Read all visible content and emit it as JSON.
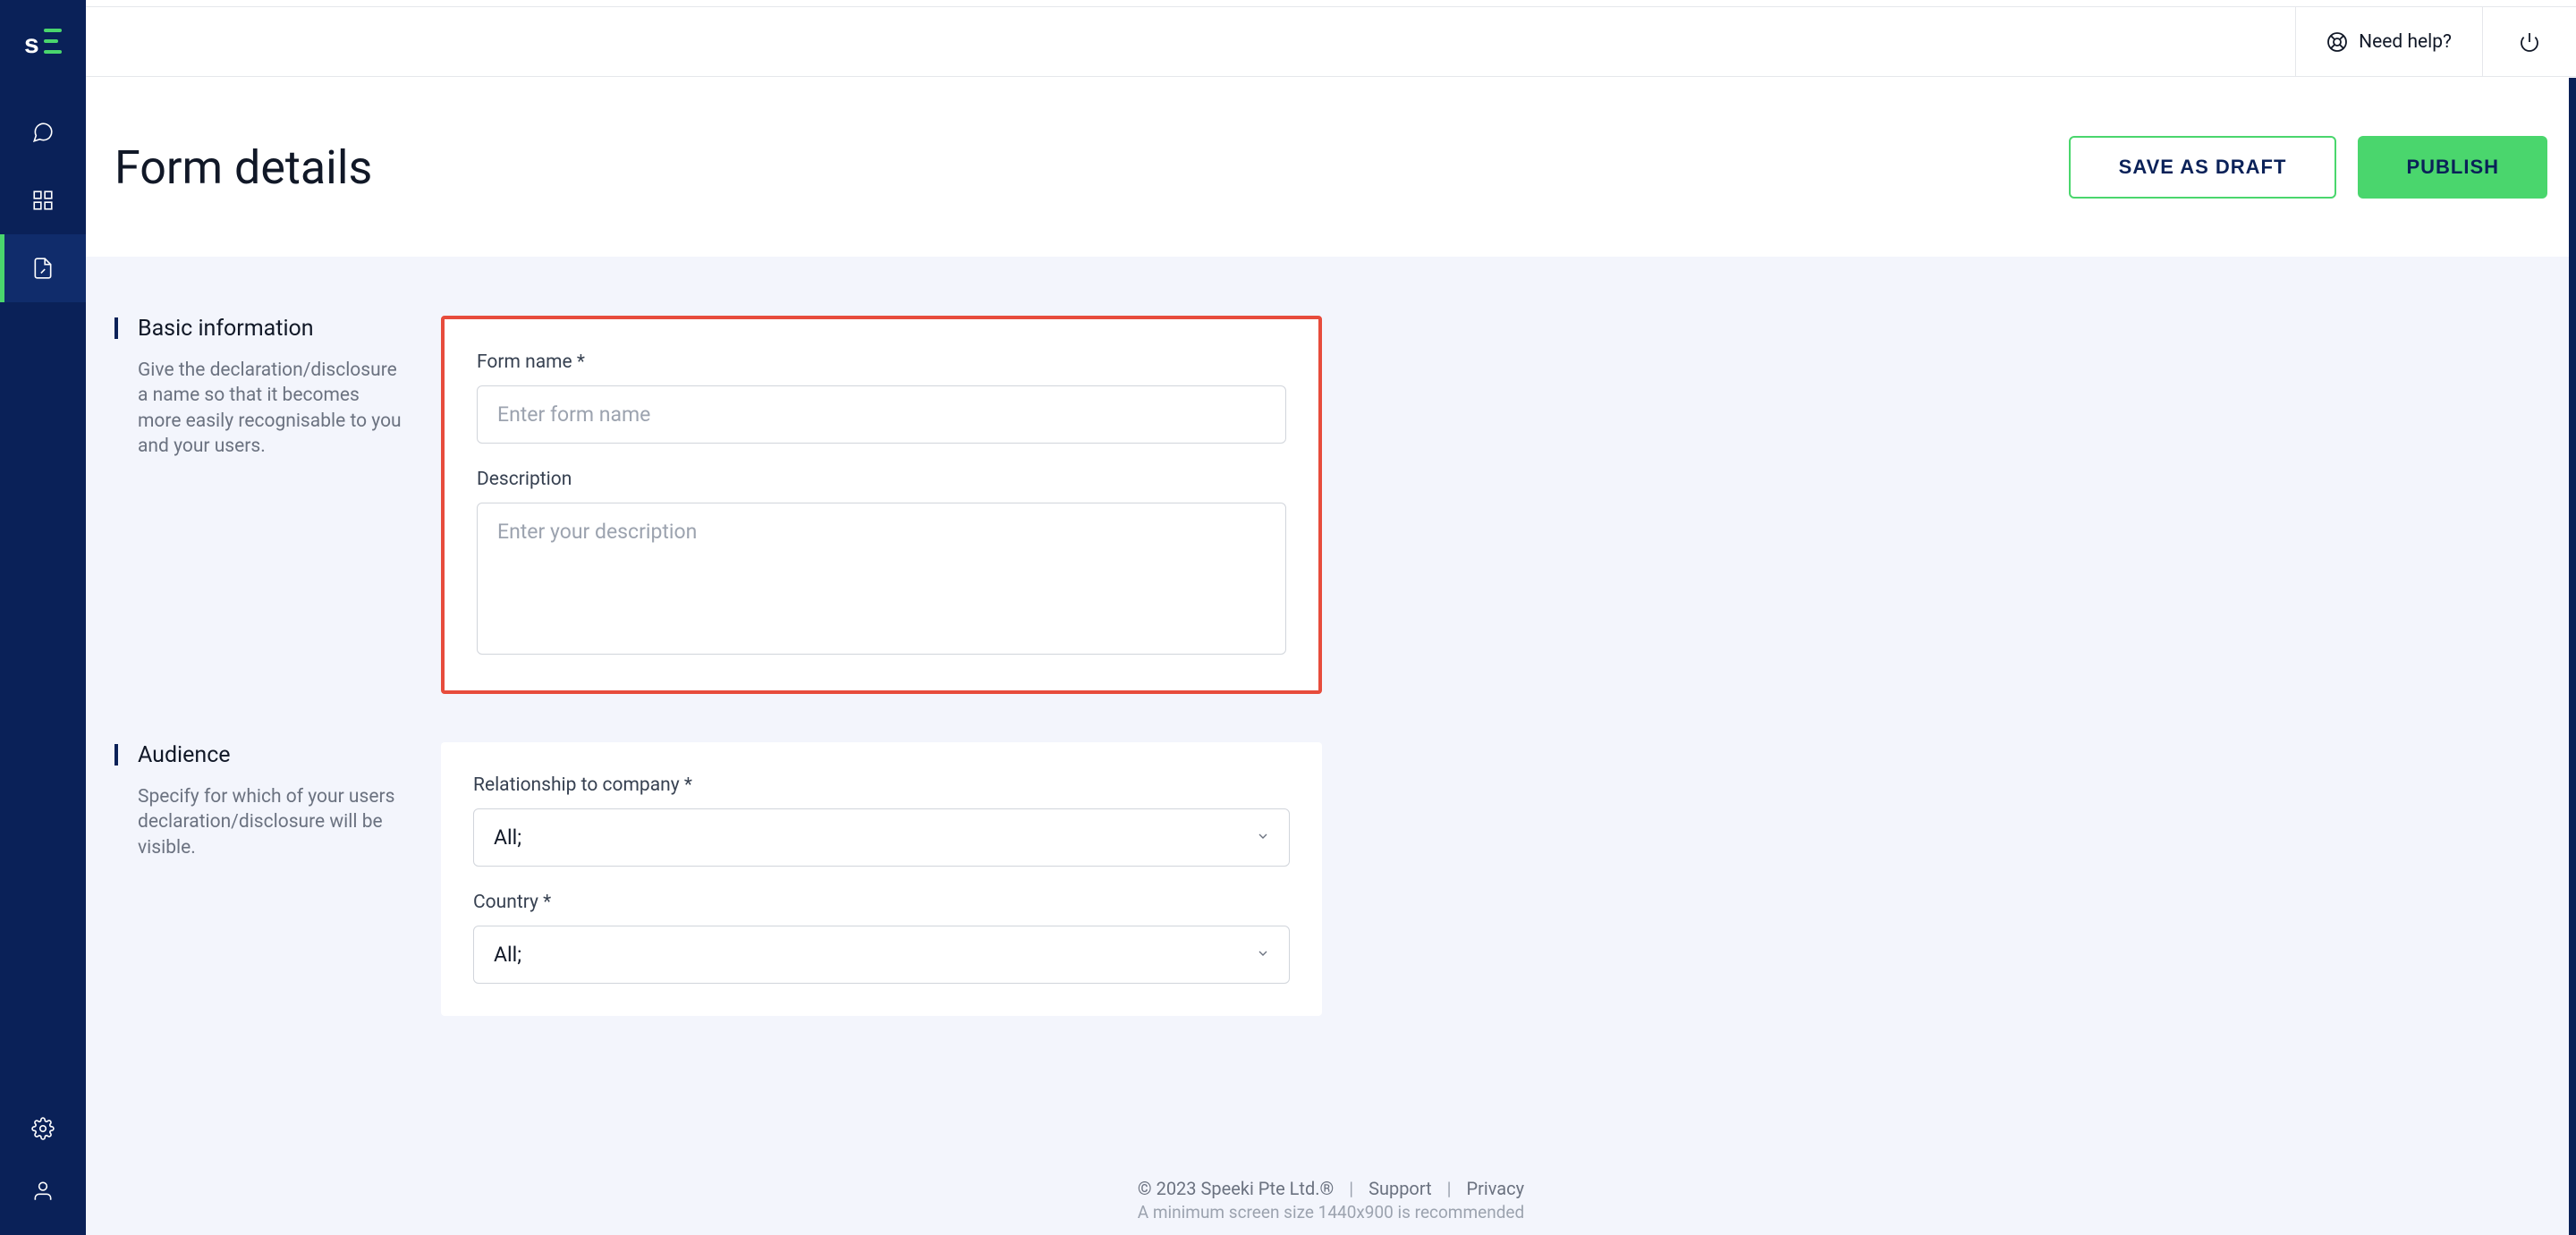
{
  "header": {
    "title": "Form details",
    "need_help": "Need help?",
    "save_draft": "SAVE AS DRAFT",
    "publish": "PUBLISH"
  },
  "sections": {
    "basic": {
      "title": "Basic information",
      "desc": "Give the declaration/disclosure a name so that it becomes more easily recognisable to you and your users.",
      "form_name_label": "Form name *",
      "form_name_placeholder": "Enter form name",
      "description_label": "Description",
      "description_placeholder": "Enter your description"
    },
    "audience": {
      "title": "Audience",
      "desc": "Specify for which of your users declaration/disclosure will be visible.",
      "relationship_label": "Relationship to company *",
      "relationship_value": "All;",
      "country_label": "Country *",
      "country_value": "All;"
    }
  },
  "footer": {
    "copyright": "© 2023 Speeki Pte Ltd.®",
    "support": "Support",
    "privacy": "Privacy",
    "min_size": "A minimum screen size 1440x900 is recommended"
  }
}
